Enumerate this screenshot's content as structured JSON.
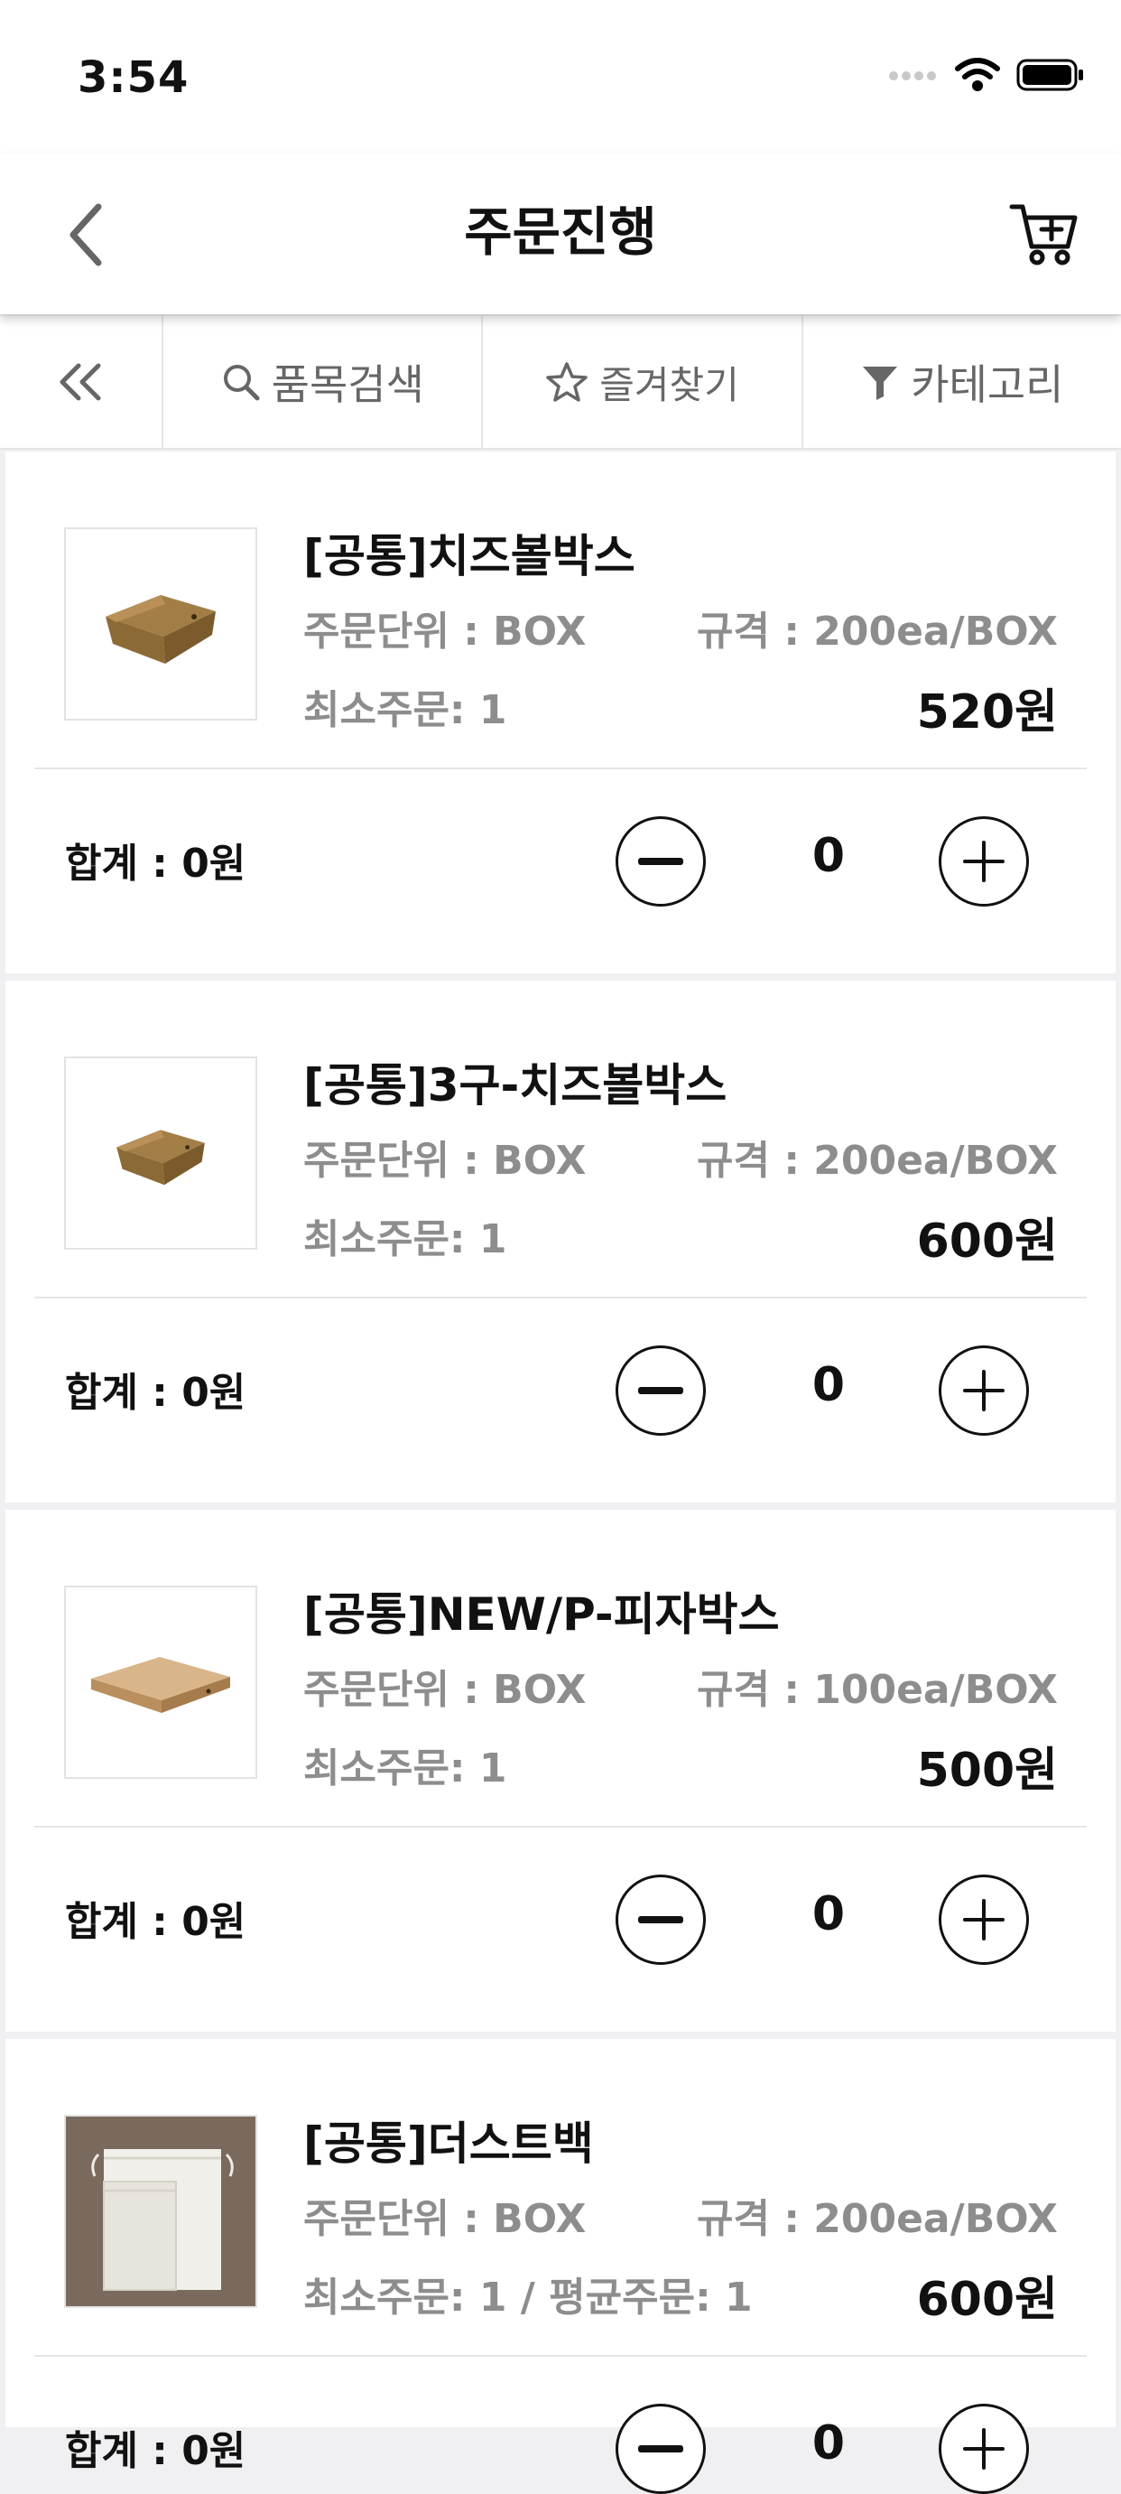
{
  "status": {
    "time": "3:54"
  },
  "header": {
    "title": "주문진행"
  },
  "filters": [
    {
      "label": "품목검색"
    },
    {
      "label": "즐겨찾기"
    },
    {
      "label": "카테고리"
    }
  ],
  "products": [
    {
      "name": "[공통]치즈볼박스",
      "unit": "주문단위 : BOX",
      "spec": "규격 : 200ea/BOX",
      "min": "최소주문: 1",
      "price": "520원",
      "total": "합계 : 0원",
      "qty": "0"
    },
    {
      "name": "[공통]3구-치즈볼박스",
      "unit": "주문단위 : BOX",
      "spec": "규격 : 200ea/BOX",
      "min": "최소주문: 1",
      "price": "600원",
      "total": "합계 : 0원",
      "qty": "0"
    },
    {
      "name": "[공통]NEW/P-피자박스",
      "unit": "주문단위 : BOX",
      "spec": "규격 : 100ea/BOX",
      "min": "최소주문: 1",
      "price": "500원",
      "total": "합계 : 0원",
      "qty": "0"
    },
    {
      "name": "[공통]더스트백",
      "unit": "주문단위 : BOX",
      "spec": "규격 : 200ea/BOX",
      "min": "최소주문: 1 / 평균주문: 1",
      "price": "600원",
      "total": "합계 : 0원",
      "qty": "0"
    }
  ]
}
